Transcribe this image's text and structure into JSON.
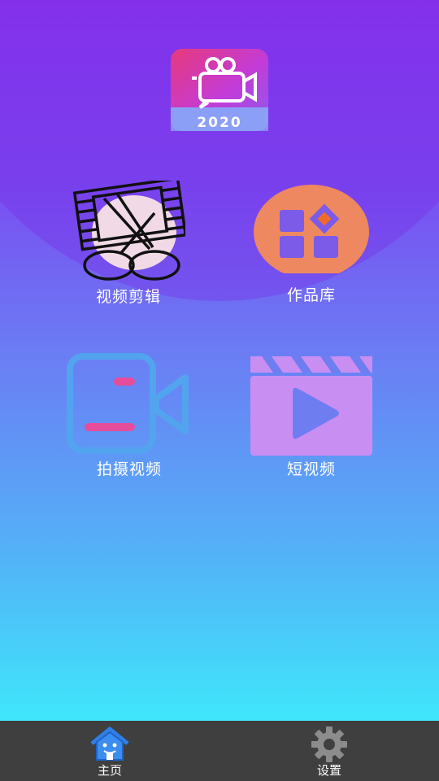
{
  "app": {
    "logo_year": "2020",
    "colors": {
      "bg_top": "#8a35ef",
      "bg_bottom": "#3fe6fb",
      "gallery_orange": "#ee8860",
      "record_pink": "#e54d9a",
      "clapper_lilac": "#c98ef2",
      "navbar": "#3f3f3f"
    }
  },
  "menu": {
    "video_edit": {
      "label": "视频剪辑",
      "icon": "film-scissors-icon"
    },
    "gallery": {
      "label": "作品库",
      "icon": "grid-icon"
    },
    "record": {
      "label": "拍摄视频",
      "icon": "video-camera-icon"
    },
    "short_video": {
      "label": "短视频",
      "icon": "clapperboard-play-icon"
    }
  },
  "navbar": {
    "home": {
      "label": "主页",
      "icon": "home-icon",
      "active": true
    },
    "settings": {
      "label": "设置",
      "icon": "gear-icon",
      "active": false
    }
  }
}
